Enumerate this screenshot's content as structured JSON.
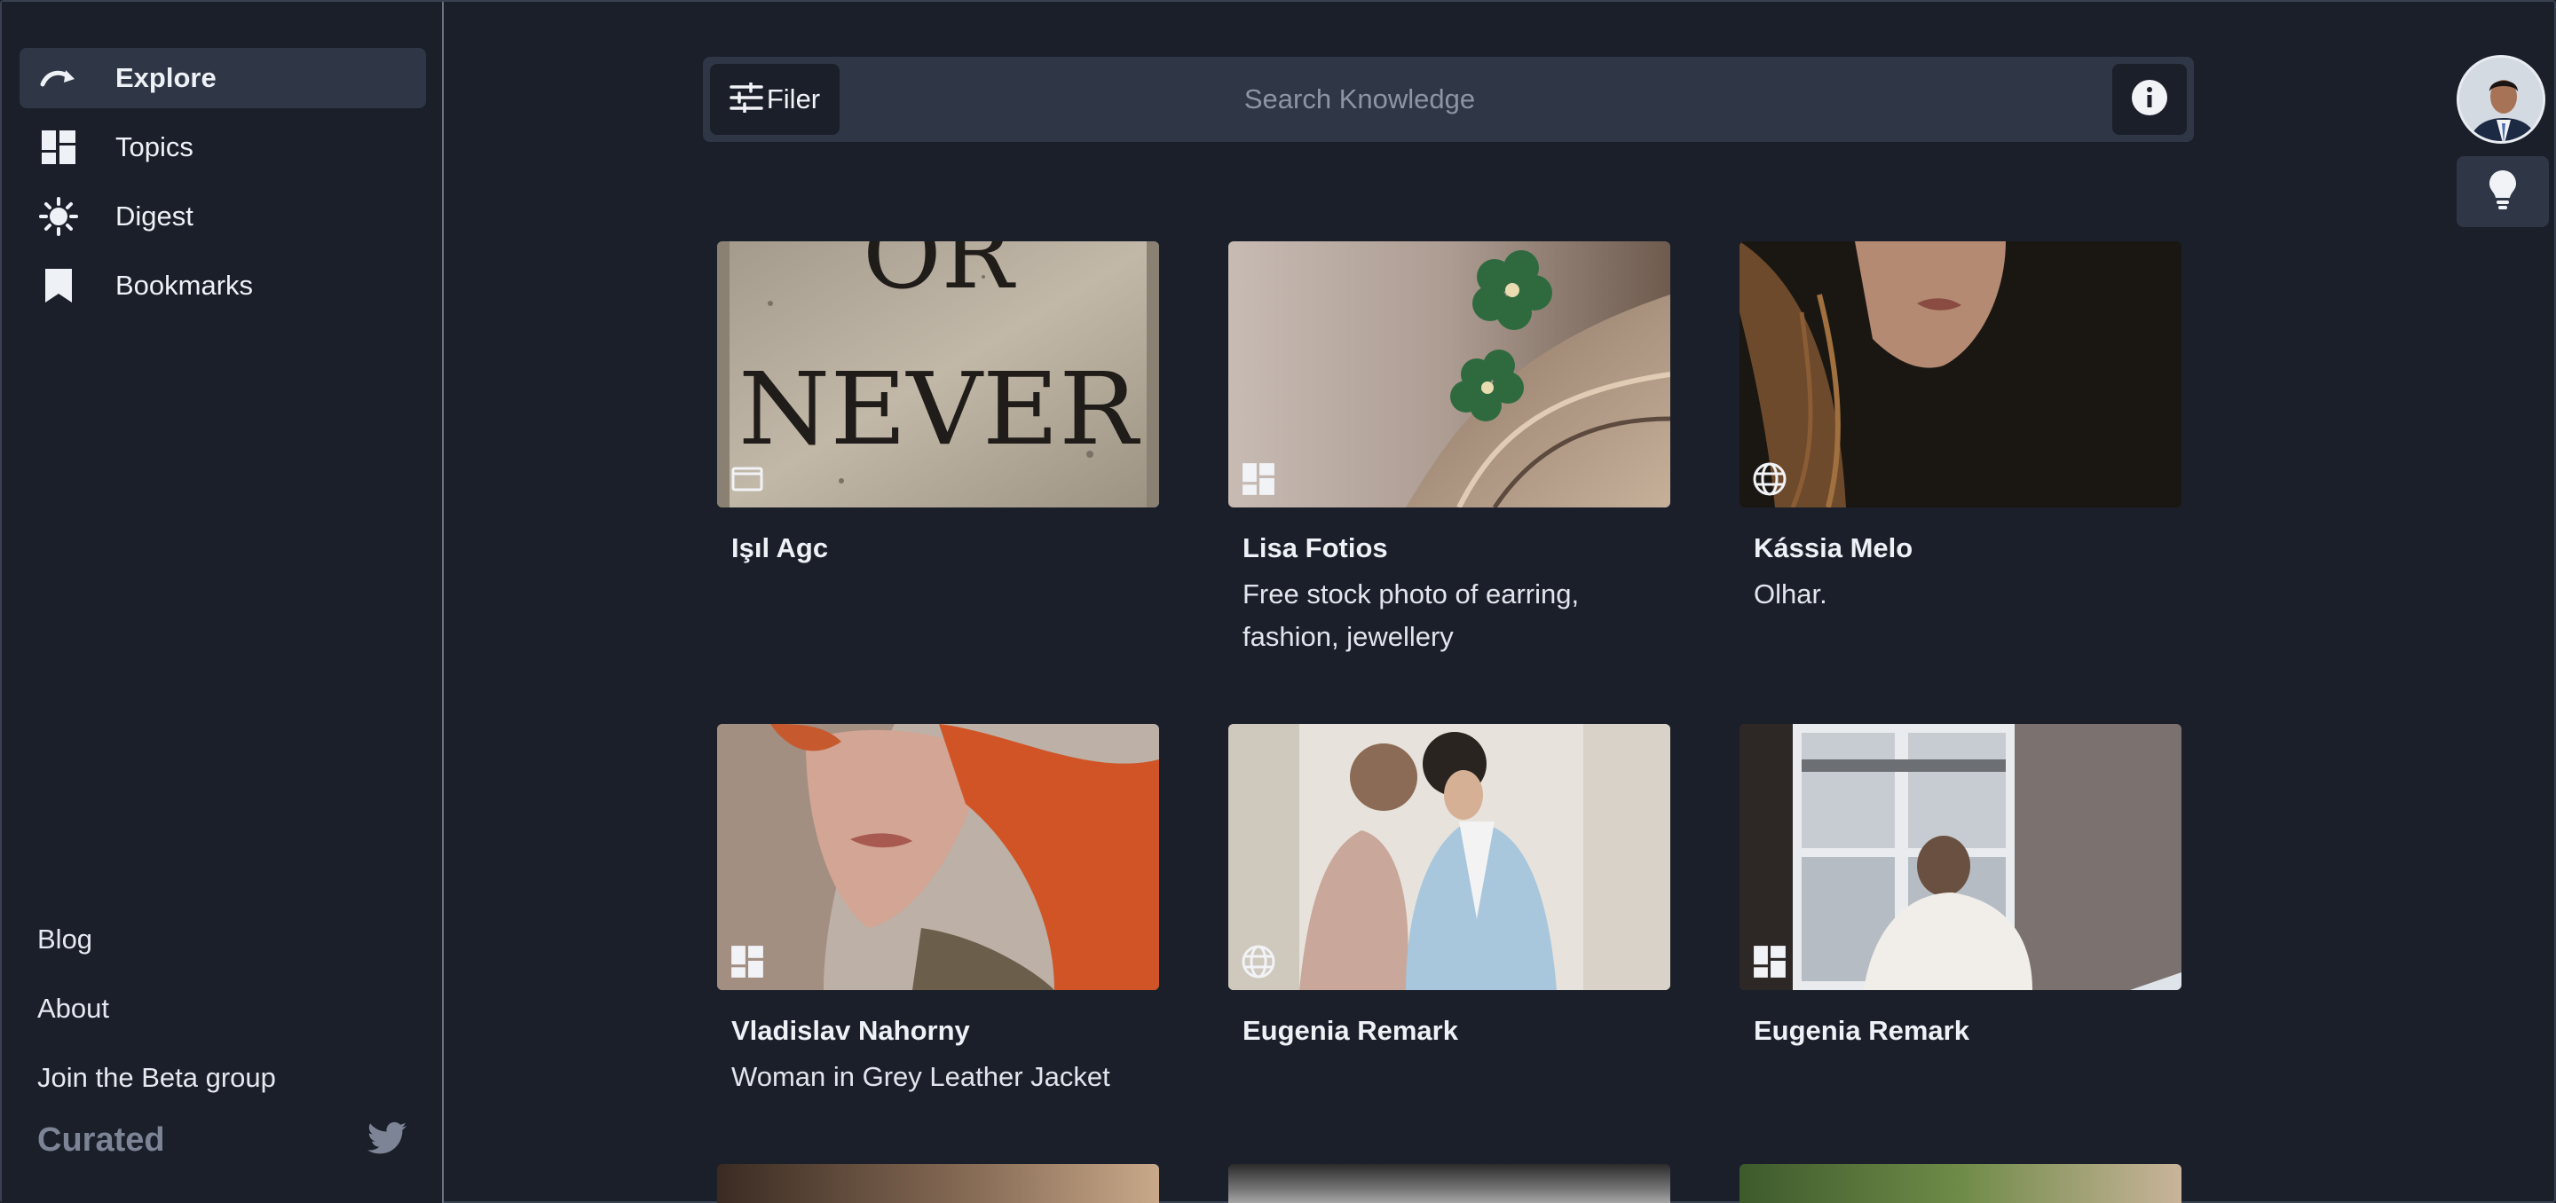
{
  "sidebar": {
    "nav": [
      {
        "label": "Explore",
        "icon": "explore-icon",
        "active": true
      },
      {
        "label": "Topics",
        "icon": "topics-icon",
        "active": false
      },
      {
        "label": "Digest",
        "icon": "sun-icon",
        "active": false
      },
      {
        "label": "Bookmarks",
        "icon": "bookmark-icon",
        "active": false
      }
    ],
    "footer": [
      {
        "label": "Blog"
      },
      {
        "label": "About"
      },
      {
        "label": "Join the Beta group"
      }
    ],
    "brand": "Curated"
  },
  "header": {
    "filter_label": "Filer",
    "search_placeholder": "Search Knowledge"
  },
  "colors": {
    "background": "#1b1f2a",
    "panel": "#2f3646",
    "text": "#e6e9ef",
    "muted": "#7c8496"
  },
  "cards": [
    {
      "title": "Işıl Agc",
      "desc": "",
      "badge": "window-icon"
    },
    {
      "title": "Lisa Fotios",
      "desc": "Free stock photo of earring, fashion, jewellery",
      "badge": "topics-icon"
    },
    {
      "title": "Kássia Melo",
      "desc": "Olhar.",
      "badge": "globe-icon"
    },
    {
      "title": "Vladislav Nahorny",
      "desc": "Woman in Grey Leather Jacket",
      "badge": "topics-icon"
    },
    {
      "title": "Eugenia Remark",
      "desc": "",
      "badge": "globe-icon"
    },
    {
      "title": "Eugenia Remark",
      "desc": "",
      "badge": "topics-icon"
    }
  ],
  "card1_image_text": "OR NEVER"
}
